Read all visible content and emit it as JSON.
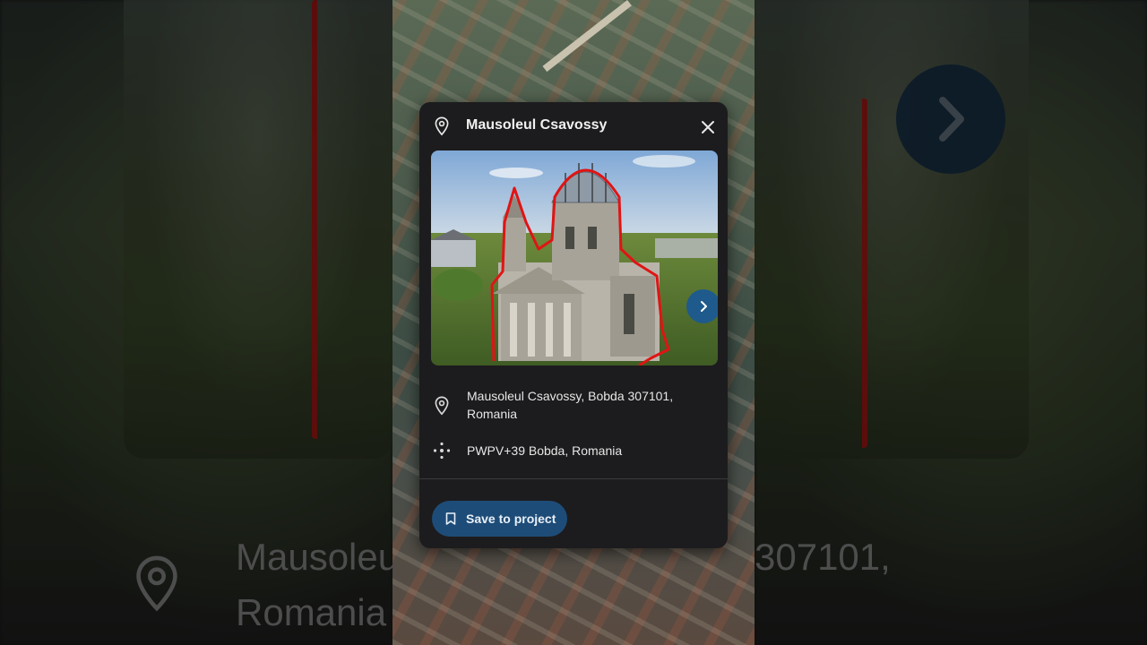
{
  "card": {
    "title": "Mausoleul Csavossy",
    "address": "Mausoleul Csavossy, Bobda 307101, Romania",
    "plus_code": "PWPV+39 Bobda, Romania",
    "save_label": "Save to project"
  },
  "background": {
    "text_line1": "Mausoleu",
    "text_line1_right": "307101,",
    "text_line2": "Romania"
  },
  "icons": {
    "pin": "map-pin-icon",
    "close": "close-icon",
    "next": "chevron-right-icon",
    "plus_code": "plus-code-icon",
    "bookmark": "bookmark-icon"
  },
  "colors": {
    "card_bg": "#1c1c1e",
    "accent": "#1e4c78",
    "next_button": "#1f5a8c",
    "outline_red": "#e01414"
  }
}
